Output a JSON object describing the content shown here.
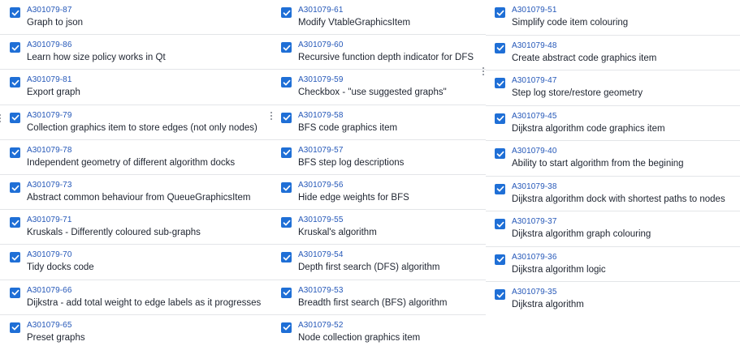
{
  "columns": [
    {
      "items": [
        {
          "key": "A301079-87",
          "summary": "Graph to json"
        },
        {
          "key": "A301079-86",
          "summary": "Learn how size policy works in Qt"
        },
        {
          "key": "A301079-81",
          "summary": "Export graph"
        },
        {
          "key": "A301079-79",
          "summary": "Collection graphics item to store edges (not only nodes)"
        },
        {
          "key": "A301079-78",
          "summary": "Independent geometry of different algorithm docks"
        },
        {
          "key": "A301079-73",
          "summary": "Abstract common behaviour from QueueGraphicsItem"
        },
        {
          "key": "A301079-71",
          "summary": "Kruskals - Differently coloured sub-graphs"
        },
        {
          "key": "A301079-70",
          "summary": "Tidy docks code"
        },
        {
          "key": "A301079-66",
          "summary": "Dijkstra - add total weight to edge labels as it progresses"
        },
        {
          "key": "A301079-65",
          "summary": "Preset graphs"
        }
      ]
    },
    {
      "items": [
        {
          "key": "A301079-61",
          "summary": "Modify VtableGraphicsItem"
        },
        {
          "key": "A301079-60",
          "summary": "Recursive function depth indicator for DFS"
        },
        {
          "key": "A301079-59",
          "summary": "Checkbox - \"use suggested graphs\""
        },
        {
          "key": "A301079-58",
          "summary": "BFS code graphics item"
        },
        {
          "key": "A301079-57",
          "summary": "BFS step log descriptions"
        },
        {
          "key": "A301079-56",
          "summary": "Hide edge weights for BFS"
        },
        {
          "key": "A301079-55",
          "summary": "Kruskal's algorithm"
        },
        {
          "key": "A301079-54",
          "summary": "Depth first search (DFS) algorithm"
        },
        {
          "key": "A301079-53",
          "summary": "Breadth first search (BFS) algorithm"
        },
        {
          "key": "A301079-52",
          "summary": "Node collection graphics item"
        }
      ]
    },
    {
      "items": [
        {
          "key": "A301079-51",
          "summary": "Simplify code item colouring"
        },
        {
          "key": "A301079-48",
          "summary": "Create abstract code graphics item"
        },
        {
          "key": "A301079-47",
          "summary": "Step log store/restore geometry"
        },
        {
          "key": "A301079-45",
          "summary": "Dijkstra algorithm code graphics item"
        },
        {
          "key": "A301079-40",
          "summary": "Ability to start algorithm from the begining"
        },
        {
          "key": "A301079-38",
          "summary": "Dijkstra algorithm dock with shortest paths to nodes"
        },
        {
          "key": "A301079-37",
          "summary": "Dijkstra algorithm graph colouring"
        },
        {
          "key": "A301079-36",
          "summary": "Dijkstra algorithm logic"
        },
        {
          "key": "A301079-35",
          "summary": "Dijkstra algorithm"
        }
      ]
    }
  ],
  "checkbox_color": "#1f6fd6",
  "key_color": "#2457b8",
  "checkbox_state": "checked",
  "checkbox_icon": "check-icon",
  "drag_handle_icon": "drag-handle-icon"
}
